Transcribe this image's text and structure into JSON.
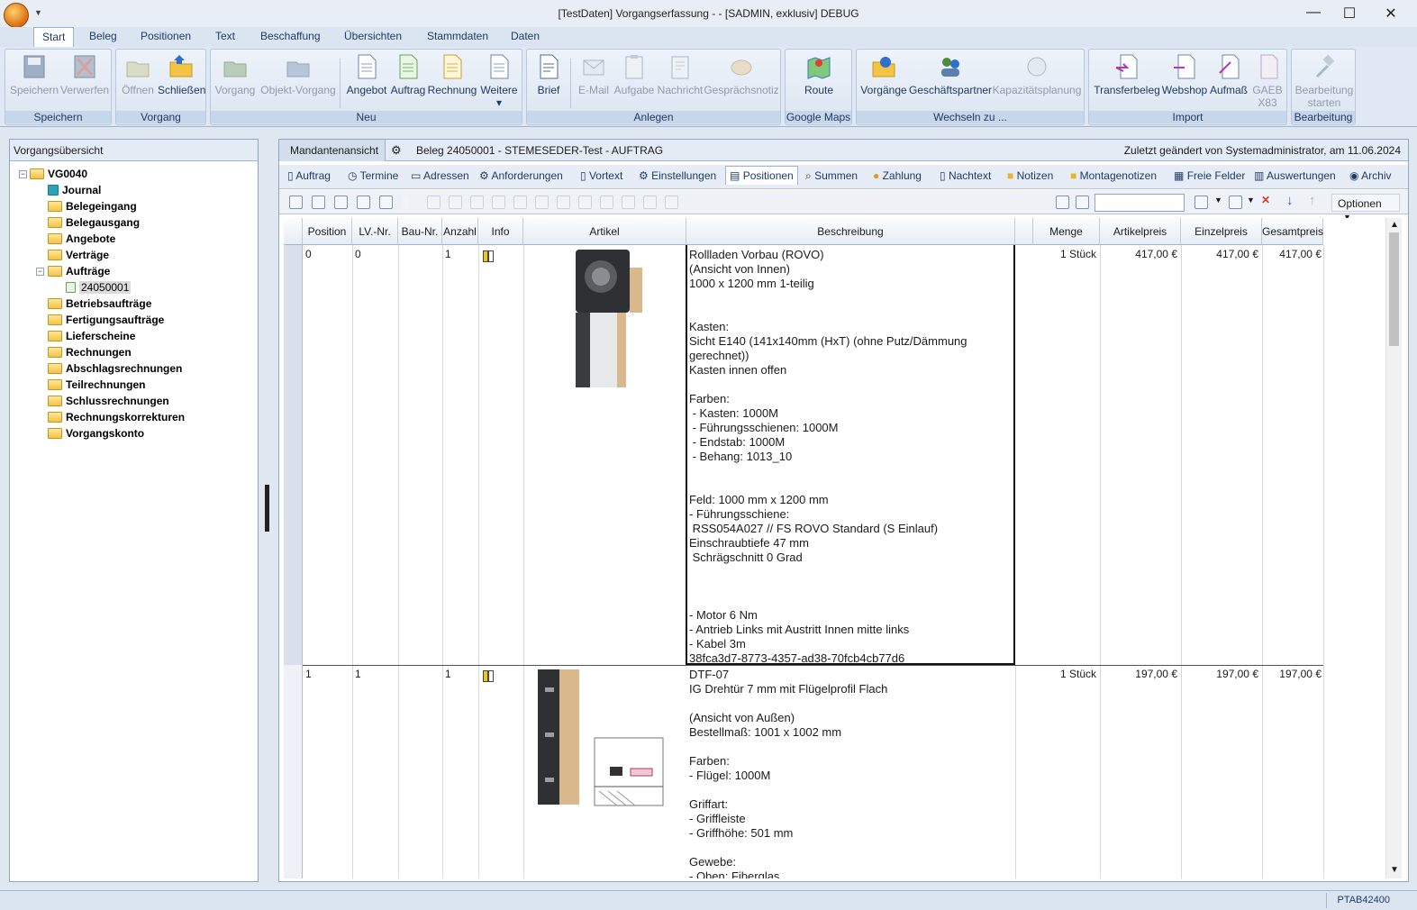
{
  "window": {
    "title": "[TestDaten] Vorgangserfassung -  - [SADMIN, exklusiv] DEBUG"
  },
  "menu": [
    "Start",
    "Beleg",
    "Positionen",
    "Text",
    "Beschaffung",
    "Übersichten",
    "Stammdaten",
    "Daten"
  ],
  "ribbon": {
    "groups": [
      "Speichern",
      "Vorgang",
      "Neu",
      "Anlegen",
      "Google Maps",
      "Wechseln zu ...",
      "Import",
      "Bearbeitung"
    ],
    "buttons": {
      "speichern": "Speichern",
      "verwerfen": "Verwerfen",
      "oeffnen": "Öffnen",
      "schliessen": "Schließen",
      "vorgang": "Vorgang",
      "objekt_vorgang": "Objekt-Vorgang",
      "angebot": "Angebot",
      "auftrag": "Auftrag",
      "rechnung": "Rechnung",
      "weitere": "Weitere",
      "brief": "Brief",
      "email": "E-Mail",
      "aufgabe": "Aufgabe",
      "nachricht": "Nachricht",
      "gespraechsnotiz": "Gesprächsnotiz",
      "route": "Route",
      "vorgaenge": "Vorgänge",
      "geschaeftspartner": "Geschäftspartner",
      "kapazitaet": "Kapazitätsplanung",
      "transferbeleg": "Transferbeleg",
      "webshop": "Webshop",
      "aufmass": "Aufmaß",
      "gaeb1": "GAEB",
      "gaeb2": "X83",
      "bearbeitung1": "Bearbeitung",
      "bearbeitung2": "starten"
    }
  },
  "left": {
    "header": "Vorgangsübersicht",
    "root": "VG0040",
    "items": [
      "Journal",
      "Belegeingang",
      "Belegausgang",
      "Angebote",
      "Verträge",
      "Aufträge",
      "24050001",
      "Betriebsaufträge",
      "Fertigungsaufträge",
      "Lieferscheine",
      "Rechnungen",
      "Abschlagsrechnungen",
      "Teilrechnungen",
      "Schlussrechnungen",
      "Rechnungskorrekturen",
      "Vorgangskonto"
    ]
  },
  "main": {
    "view": "Mandantenansicht",
    "beleg": "Beleg 24050001 - STEMESEDER-Test - AUFTRAG",
    "changed": "Zuletzt geändert von Systemadministrator, am 11.06.2024",
    "tabs": [
      "Auftrag",
      "Termine",
      "Adressen",
      "Anforderungen",
      "Vortext",
      "Einstellungen",
      "Positionen",
      "Summen",
      "Zahlung",
      "Nachtext",
      "Notizen",
      "Montagenotizen",
      "Freie Felder",
      "Auswertungen",
      "Archiv"
    ],
    "options": "Optionen",
    "columns": [
      "Position",
      "LV.-Nr.",
      "Bau-Nr.",
      "Anzahl",
      "Info",
      "Artikel",
      "Beschreibung",
      "Menge",
      "Artikelpreis",
      "Einzelpreis",
      "Gesamtpreis"
    ],
    "rows": [
      {
        "position": "0",
        "lv": "0",
        "anzahl": "1",
        "menge": "1 Stück",
        "artikelpreis": "417,00 €",
        "einzelpreis": "417,00 €",
        "gesamtpreis": "417,00 €",
        "desc": "Rollladen Vorbau (ROVO)\n(Ansicht von Innen)\n1000 x 1200 mm 1-teilig\n\n\nKasten:\nSicht E140 (141x140mm (HxT) (ohne Putz/Dämmung\ngerechnet))\nKasten innen offen\n\nFarben:\n - Kasten: 1000M\n - Führungsschienen: 1000M\n - Endstab: 1000M\n - Behang: 1013_10\n\n\nFeld: 1000 mm x 1200 mm\n- Führungsschiene:\n RSS054A027 // FS ROVO Standard (S Einlauf)\nEinschraubtiefe 47 mm\n Schrägschnitt 0 Grad\n\n\n\n- Motor 6 Nm\n- Antrieb Links mit Austritt Innen mitte links\n- Kabel 3m\n38fca3d7-8773-4357-ad38-70fcb4cb77d6"
      },
      {
        "position": "1",
        "lv": "1",
        "anzahl": "1",
        "menge": "1 Stück",
        "artikelpreis": "197,00 €",
        "einzelpreis": "197,00 €",
        "gesamtpreis": "197,00 €",
        "desc": "DTF-07\nIG Drehtür 7 mm mit Flügelprofil Flach\n\n(Ansicht von Außen)\nBestellmaß: 1001 x 1002 mm\n\nFarben:\n- Flügel: 1000M\n\nGriffart:\n- Griffleiste\n- Griffhöhe: 501 mm\n\nGewebe:\n- Oben: Fiberglas"
      }
    ]
  },
  "status": "PTAB42400"
}
